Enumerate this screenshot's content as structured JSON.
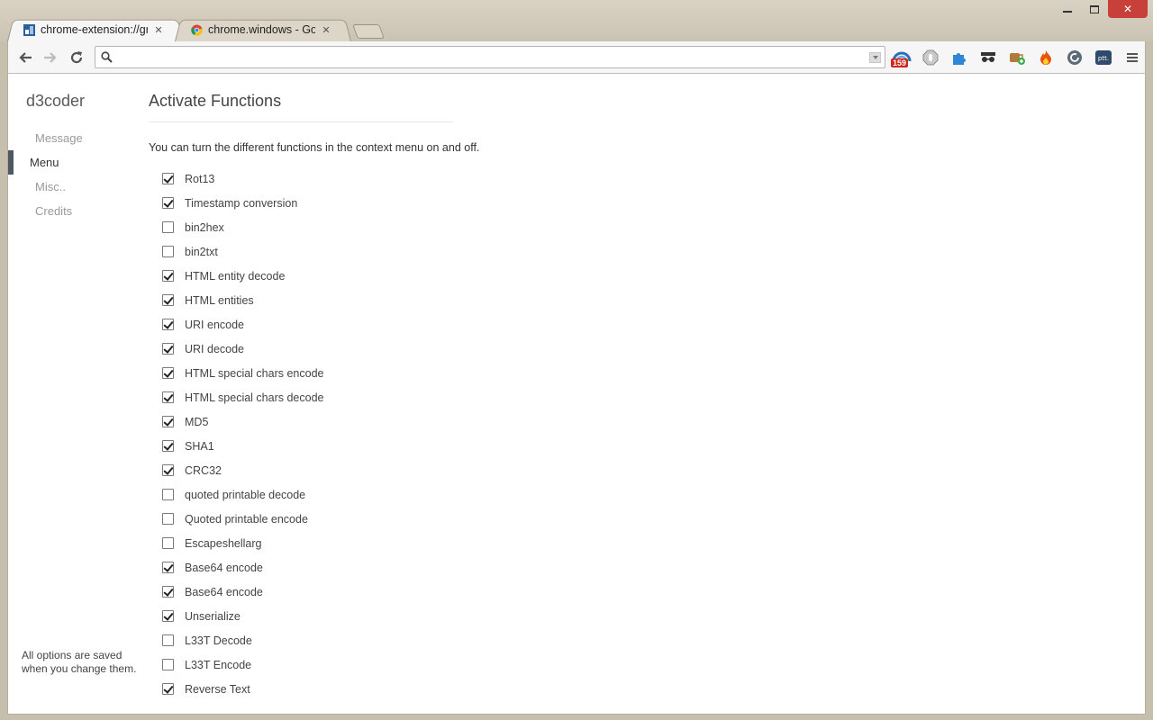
{
  "tabs": [
    {
      "title": "chrome-extension://gncn",
      "active": true,
      "favicon": "d3coder-icon"
    },
    {
      "title": "chrome.windows - Google",
      "active": false,
      "favicon": "chrome-logo-icon"
    }
  ],
  "toolbar": {
    "omnibox_value": "",
    "extensions": [
      {
        "name": "mail-notifier-icon",
        "badge": "159"
      },
      {
        "name": "adblock-hand-icon"
      },
      {
        "name": "puzzle-piece-icon"
      },
      {
        "name": "incognito-mask-icon"
      },
      {
        "name": "coffee-cup-plus-icon"
      },
      {
        "name": "flame-icon"
      },
      {
        "name": "circle-refresh-icon"
      },
      {
        "name": "ptt-icon",
        "label": "ptt."
      }
    ]
  },
  "sidebar": {
    "app_title": "d3coder",
    "items": [
      {
        "label": "Message",
        "selected": false
      },
      {
        "label": "Menu",
        "selected": true
      },
      {
        "label": "Misc..",
        "selected": false
      },
      {
        "label": "Credits",
        "selected": false
      }
    ],
    "footnote": "All options are saved when you change them."
  },
  "main": {
    "title": "Activate Functions",
    "intro": "You can turn the different functions in the context menu on and off.",
    "options": [
      {
        "label": "Rot13",
        "checked": true
      },
      {
        "label": "Timestamp conversion",
        "checked": true
      },
      {
        "label": "bin2hex",
        "checked": false
      },
      {
        "label": "bin2txt",
        "checked": false
      },
      {
        "label": "HTML entity decode",
        "checked": true
      },
      {
        "label": "HTML entities",
        "checked": true
      },
      {
        "label": "URI encode",
        "checked": true
      },
      {
        "label": "URI decode",
        "checked": true
      },
      {
        "label": "HTML special chars encode",
        "checked": true
      },
      {
        "label": "HTML special chars decode",
        "checked": true
      },
      {
        "label": "MD5",
        "checked": true
      },
      {
        "label": "SHA1",
        "checked": true
      },
      {
        "label": "CRC32",
        "checked": true
      },
      {
        "label": "quoted printable decode",
        "checked": false
      },
      {
        "label": "Quoted printable encode",
        "checked": false
      },
      {
        "label": "Escapeshellarg",
        "checked": false
      },
      {
        "label": "Base64 encode",
        "checked": true
      },
      {
        "label": "Base64 encode",
        "checked": true
      },
      {
        "label": "Unserialize",
        "checked": true
      },
      {
        "label": "L33T Decode",
        "checked": false
      },
      {
        "label": "L33T Encode",
        "checked": false
      },
      {
        "label": "Reverse Text",
        "checked": true
      }
    ]
  },
  "colors": {
    "frame": "#c7bfae",
    "close_button": "#c7403a",
    "nav_selected_bar": "#4e5764"
  }
}
